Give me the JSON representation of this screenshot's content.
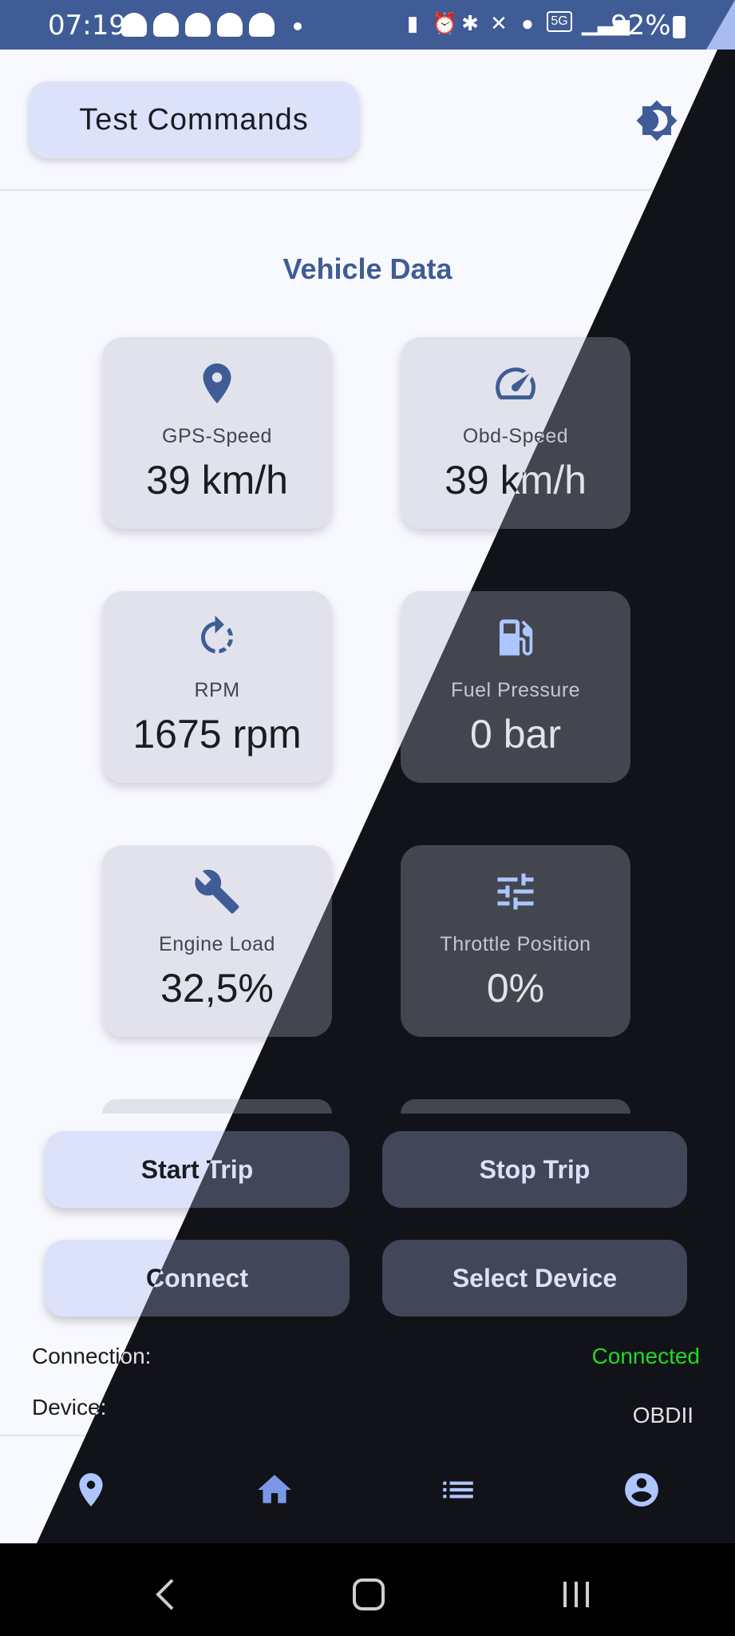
{
  "status_bar": {
    "time": "07:19",
    "battery": "92%",
    "network": "5G"
  },
  "top_bar": {
    "test_commands": "Test Commands",
    "theme_icon": "brightness-contrast-icon"
  },
  "section_title": "Vehicle Data",
  "cards": [
    {
      "label": "GPS-Speed",
      "value": "39 km/h",
      "icon": "location-pin-icon"
    },
    {
      "label": "Obd-Speed",
      "value": "39 km/h",
      "icon": "speedometer-icon"
    },
    {
      "label": "RPM",
      "value": "1675 rpm",
      "icon": "rotate-icon"
    },
    {
      "label": "Fuel Pressure",
      "value": "0 bar",
      "icon": "fuel-pump-icon"
    },
    {
      "label": "Engine Load",
      "value": "32,5%",
      "icon": "wrench-icon"
    },
    {
      "label": "Throttle Position",
      "value": "0%",
      "icon": "sliders-icon"
    }
  ],
  "buttons": {
    "start_trip": "Start Trip",
    "stop_trip": "Stop Trip",
    "connect": "Connect",
    "select_device": "Select Device"
  },
  "info": {
    "connection_label": "Connection:",
    "connection_value": "Connected",
    "device_label": "Device:",
    "device_value": "OBDII"
  },
  "nav": [
    "location-icon",
    "home-icon",
    "list-icon",
    "account-icon"
  ],
  "colors": {
    "primary": "#3f5c96",
    "primary_dark": "#adc6ff",
    "connected": "#1edc1e"
  }
}
